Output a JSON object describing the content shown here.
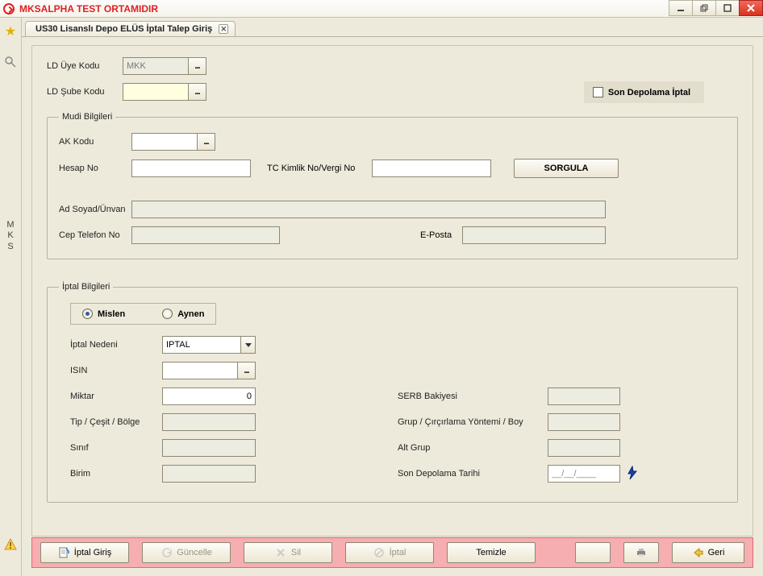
{
  "window": {
    "title": "MKSALPHA TEST ORTAMIDIR"
  },
  "sidebar": {
    "vertical_label_chars": [
      "M",
      "K",
      "S"
    ]
  },
  "tab": {
    "title": "US30 Lisanslı Depo ELÜS İptal Talep Giriş"
  },
  "top_fields": {
    "ld_uye_kodu_label": "LD Üye Kodu",
    "ld_uye_kodu_value": "MKK",
    "ld_sube_kodu_label": "LD Şube Kodu",
    "ld_sube_kodu_value": ""
  },
  "son_depo": {
    "label": "Son Depolama İptal"
  },
  "mudi": {
    "legend": "Mudi Bilgileri",
    "ak_kodu_label": "AK Kodu",
    "ak_kodu_value": "",
    "hesap_no_label": "Hesap No",
    "hesap_no_value": "",
    "tc_label": "TC Kimlik No/Vergi No",
    "tc_value": "",
    "sorgula_label": "SORGULA",
    "ad_label": "Ad Soyad/Ünvan",
    "ad_value": "",
    "cep_label": "Cep Telefon No",
    "cep_value": "",
    "eposta_label": "E-Posta",
    "eposta_value": ""
  },
  "iptal": {
    "legend": "İptal Bilgileri",
    "radio_mislen": "Mislen",
    "radio_aynen": "Aynen",
    "nedeni_label": "İptal Nedeni",
    "nedeni_value": "IPTAL",
    "isin_label": "ISIN",
    "isin_value": "",
    "miktar_label": "Miktar",
    "miktar_value": "0",
    "tip_label": "Tip / Çeşit / Bölge",
    "tip_value": "",
    "sinif_label": "Sınıf",
    "sinif_value": "",
    "birim_label": "Birim",
    "birim_value": "",
    "serb_label": "SERB Bakiyesi",
    "serb_value": "",
    "grup_label": "Grup / Çırçırlama Yöntemi / Boy",
    "grup_value": "",
    "altgrup_label": "Alt Grup",
    "altgrup_value": "",
    "sondepo_label": "Son Depolama Tarihi",
    "sondepo_value": "__/__/____"
  },
  "actions": {
    "iptal_giris": "İptal Giriş",
    "guncelle": "Güncelle",
    "sil": "Sil",
    "iptal": "İptal",
    "temizle": "Temizle",
    "geri": "Geri"
  }
}
